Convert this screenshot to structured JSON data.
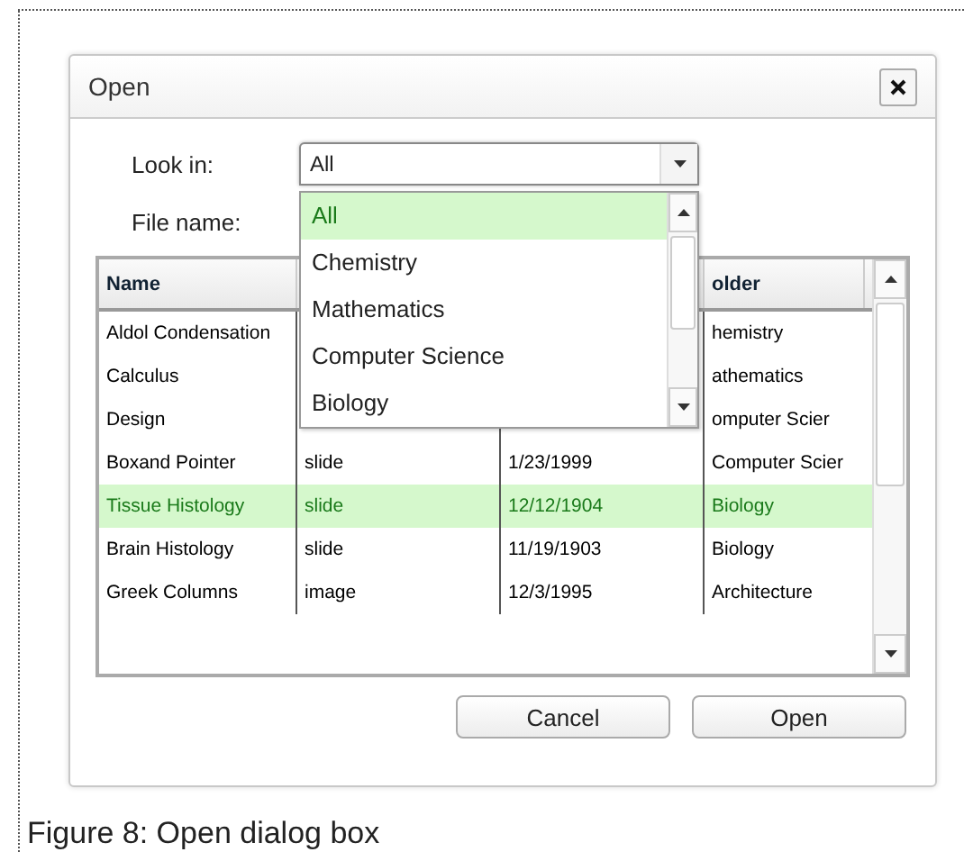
{
  "dialog": {
    "title": "Open",
    "look_in": {
      "label": "Look in:",
      "value": "All",
      "expanded": true,
      "options": [
        {
          "label": "All",
          "selected": true
        },
        {
          "label": "Chemistry",
          "selected": false
        },
        {
          "label": "Mathematics",
          "selected": false
        },
        {
          "label": "Computer Science",
          "selected": false
        },
        {
          "label": "Biology",
          "selected": false
        }
      ]
    },
    "file_name": {
      "label": "File name:"
    },
    "table": {
      "columns": [
        {
          "label": "Name"
        },
        {},
        {},
        {
          "label": "older"
        }
      ],
      "rows": [
        {
          "cells": [
            "Aldol Condensation",
            null,
            null,
            "hemistry"
          ],
          "selected": false
        },
        {
          "cells": [
            "Calculus",
            null,
            null,
            "athematics"
          ],
          "selected": false
        },
        {
          "cells": [
            "Design",
            null,
            null,
            "omputer Scier"
          ],
          "selected": false
        },
        {
          "cells": [
            "Boxand Pointer",
            "slide",
            "1/23/1999",
            "Computer Scier"
          ],
          "selected": false
        },
        {
          "cells": [
            "Tissue Histology",
            "slide",
            "12/12/1904",
            "Biology"
          ],
          "selected": true
        },
        {
          "cells": [
            "Brain Histology",
            "slide",
            "11/19/1903",
            "Biology"
          ],
          "selected": false
        },
        {
          "cells": [
            "Greek Columns",
            "image",
            "12/3/1995",
            "Architecture"
          ],
          "selected": false
        }
      ]
    },
    "buttons": [
      "Cancel",
      "Open"
    ]
  },
  "caption": "Figure 8: Open dialog box"
}
